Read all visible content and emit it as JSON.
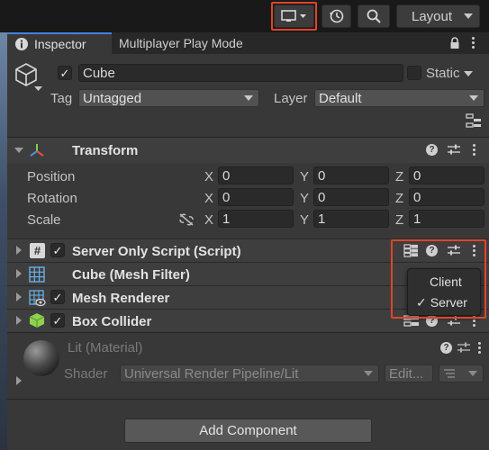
{
  "toolbar": {
    "play_mode_icon": "monitor-icon",
    "history_icon": "history-icon",
    "search_icon": "search-icon",
    "layout_label": "Layout"
  },
  "tabs": {
    "inspector": "Inspector",
    "multiplayer": "Multiplayer Play Mode"
  },
  "object": {
    "name": "Cube",
    "active": true,
    "static_label": "Static",
    "static": false,
    "tag_label": "Tag",
    "tag_value": "Untagged",
    "layer_label": "Layer",
    "layer_value": "Default"
  },
  "transform": {
    "title": "Transform",
    "rows": [
      {
        "label": "Position",
        "x": "0",
        "y": "0",
        "z": "0"
      },
      {
        "label": "Rotation",
        "x": "0",
        "y": "0",
        "z": "0"
      },
      {
        "label": "Scale",
        "x": "1",
        "y": "1",
        "z": "1"
      }
    ],
    "axis_x": "X",
    "axis_y": "Y",
    "axis_z": "Z"
  },
  "components": [
    {
      "title": "Server Only Script (Script)",
      "enabled": true,
      "icon": "script-icon"
    },
    {
      "title": "Cube (Mesh Filter)",
      "icon": "mesh-filter-icon"
    },
    {
      "title": "Mesh Renderer",
      "enabled": true,
      "icon": "mesh-renderer-icon"
    },
    {
      "title": "Box Collider",
      "enabled": true,
      "icon": "box-collider-icon"
    }
  ],
  "material": {
    "name": "Lit (Material)",
    "shader_label": "Shader",
    "shader_value": "Universal Render Pipeline/Lit",
    "edit_label": "Edit..."
  },
  "popup": {
    "items": [
      {
        "label": "Client",
        "checked": false
      },
      {
        "label": "Server",
        "checked": true
      }
    ],
    "check": "✓"
  },
  "add_component_label": "Add Component",
  "colors": {
    "highlight": "#e2432a",
    "panel": "#383838",
    "tab_accent": "#4a80e0"
  }
}
